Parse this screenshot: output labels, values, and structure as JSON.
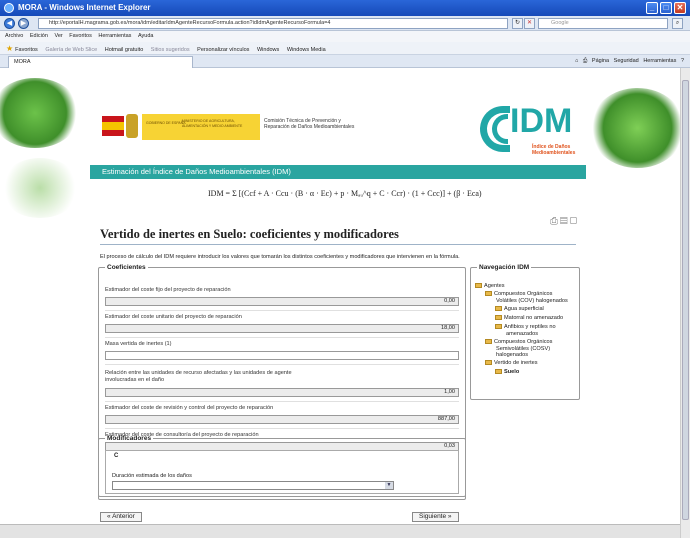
{
  "window": {
    "title": "MORA - Windows Internet Explorer",
    "url": "http://eportalH.magrama.gob.es/mora/idm/editarIdmAgenteRecursoFormula.action?idIdmAgenteRecursoFormula=4",
    "search_placeholder": "Google"
  },
  "menu": [
    "Archivo",
    "Edición",
    "Ver",
    "Favoritos",
    "Herramientas",
    "Ayuda"
  ],
  "favorites": {
    "label": "Favoritos",
    "items": [
      "Galería de Web Slice",
      "Hotmail gratuito",
      "Sitios sugeridos",
      "Personalizar vínculos",
      "Windows",
      "Windows Media"
    ]
  },
  "tab": {
    "title": "MORA"
  },
  "tab_tools": [
    "Página",
    "Seguridad",
    "Herramientas"
  ],
  "header": {
    "gov_text_1": "GOBIERNO DE ESPAÑA",
    "gov_text_2": "MINISTERIO DE AGRICULTURA, ALIMENTACIÓN Y MEDIO AMBIENTE",
    "comision": "Comisión Técnica de Prevención y Reparación de Daños Medioambientales",
    "idm_logo": "IDM",
    "idm_subtitle": "Índice de Daños Medioambientales"
  },
  "section_bar": "Estimación del Índice de Daños Medioambientales (IDM)",
  "formula": "IDM = Σ [(Ccf + A · Ccu · (B · α · Ec) + p · Mₐᵤ^q + C · Ccr) · (1 + Ccc)] + (β · Eca)",
  "page_title": "Vertido de inertes en Suelo: coeficientes y modificadores",
  "intro": "El proceso de cálculo del IDM requiere introducir los valores que tomarán los distintos coeficientes y modificadores que intervienen en la fórmula.",
  "coeficientes": {
    "legend": "Coeficientes",
    "fields": [
      {
        "label": "Estimador del coste fijo del proyecto de reparación",
        "value": "0,00",
        "readonly": true
      },
      {
        "label": "Estimador del coste unitario del proyecto de reparación",
        "value": "18,00",
        "readonly": true
      },
      {
        "label": "Masa vertida de inertes  (1)",
        "value": "",
        "readonly": false
      },
      {
        "label": "Relación entre las unidades de recurso afectadas y las unidades de agente involucradas en el daño",
        "value": "1,00",
        "readonly": true
      },
      {
        "label": "Estimador del coste de revisión y control del proyecto de reparación",
        "value": "887,00",
        "readonly": true
      },
      {
        "label": "Estimador del coste de consultoría del proyecto de reparación",
        "value": "0,03",
        "readonly": true
      }
    ]
  },
  "navigation": {
    "legend": "Navegación IDM",
    "items": [
      {
        "label": "Agentes",
        "level": 0
      },
      {
        "label": "Compuestos Orgánicos",
        "level": 1
      },
      {
        "label": "Volátiles (COV) halogenados",
        "level": 1,
        "cont": true
      },
      {
        "label": "Agua superficial",
        "level": 2
      },
      {
        "label": "Matorral no amenazado",
        "level": 2
      },
      {
        "label": "Anfibios y reptiles no",
        "level": 2
      },
      {
        "label": "amenazados",
        "level": 2,
        "cont": true
      },
      {
        "label": "Compuestos Orgánicos",
        "level": 1
      },
      {
        "label": "Semivolátiles (COSV)",
        "level": 1,
        "cont": true
      },
      {
        "label": "halogenados",
        "level": 1,
        "cont": true
      },
      {
        "label": "Vertido de inertes",
        "level": 1
      },
      {
        "label": "Suelo",
        "level": 2,
        "bold": true
      }
    ]
  },
  "modificadores": {
    "legend": "Modificadores",
    "group": "C",
    "duration_label": "Duración estimada de los daños",
    "duration_value": ""
  },
  "buttons": {
    "previous": "Anterior",
    "next": "Siguiente"
  }
}
